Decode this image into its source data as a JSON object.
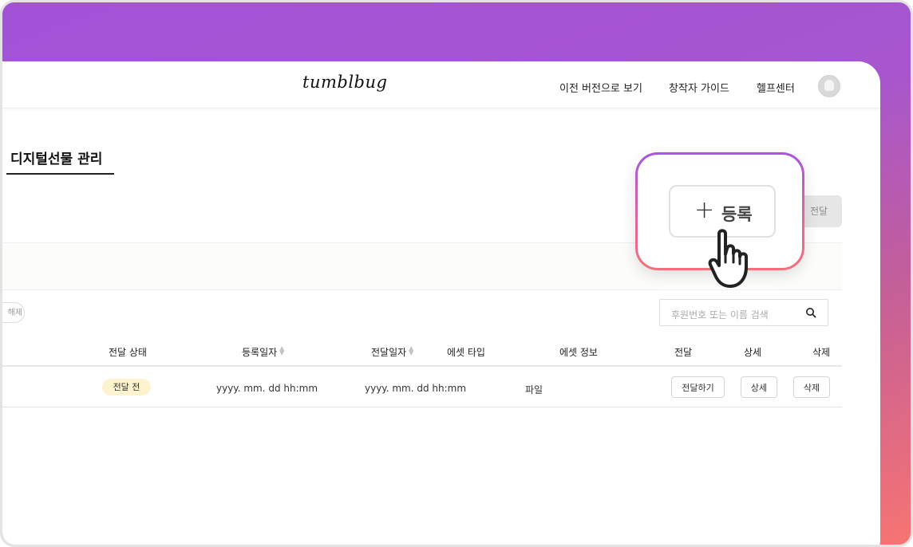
{
  "header": {
    "logo": "tumblbug",
    "nav": [
      "이전 버전으로 보기",
      "창작자 가이드",
      "헬프센터"
    ]
  },
  "page": {
    "title": "디지털선물 관리",
    "deliver_button": "전달",
    "register_button": "등록",
    "filter_chip": "해제"
  },
  "search": {
    "placeholder": "후원번호 또는 이름 검색"
  },
  "table": {
    "headers": [
      "전달 상태",
      "등록일자",
      "전달일자",
      "에셋 타입",
      "에셋 정보",
      "전달",
      "상세",
      "삭제"
    ],
    "rows": [
      {
        "status": "전달 전",
        "registered": "yyyy. mm. dd hh:mm",
        "delivered": "yyyy. mm. dd hh:mm",
        "asset_type": "파일",
        "deliver_action": "전달하기",
        "detail_action": "상세",
        "delete_action": "삭제"
      }
    ]
  },
  "icons": [
    "plus-icon",
    "search-icon",
    "pointer-hand-icon",
    "sort-icon",
    "avatar"
  ],
  "colors": {
    "gradient_start": "#a352d8",
    "gradient_end": "#f77472",
    "badge_bg": "#fdf4cf"
  }
}
